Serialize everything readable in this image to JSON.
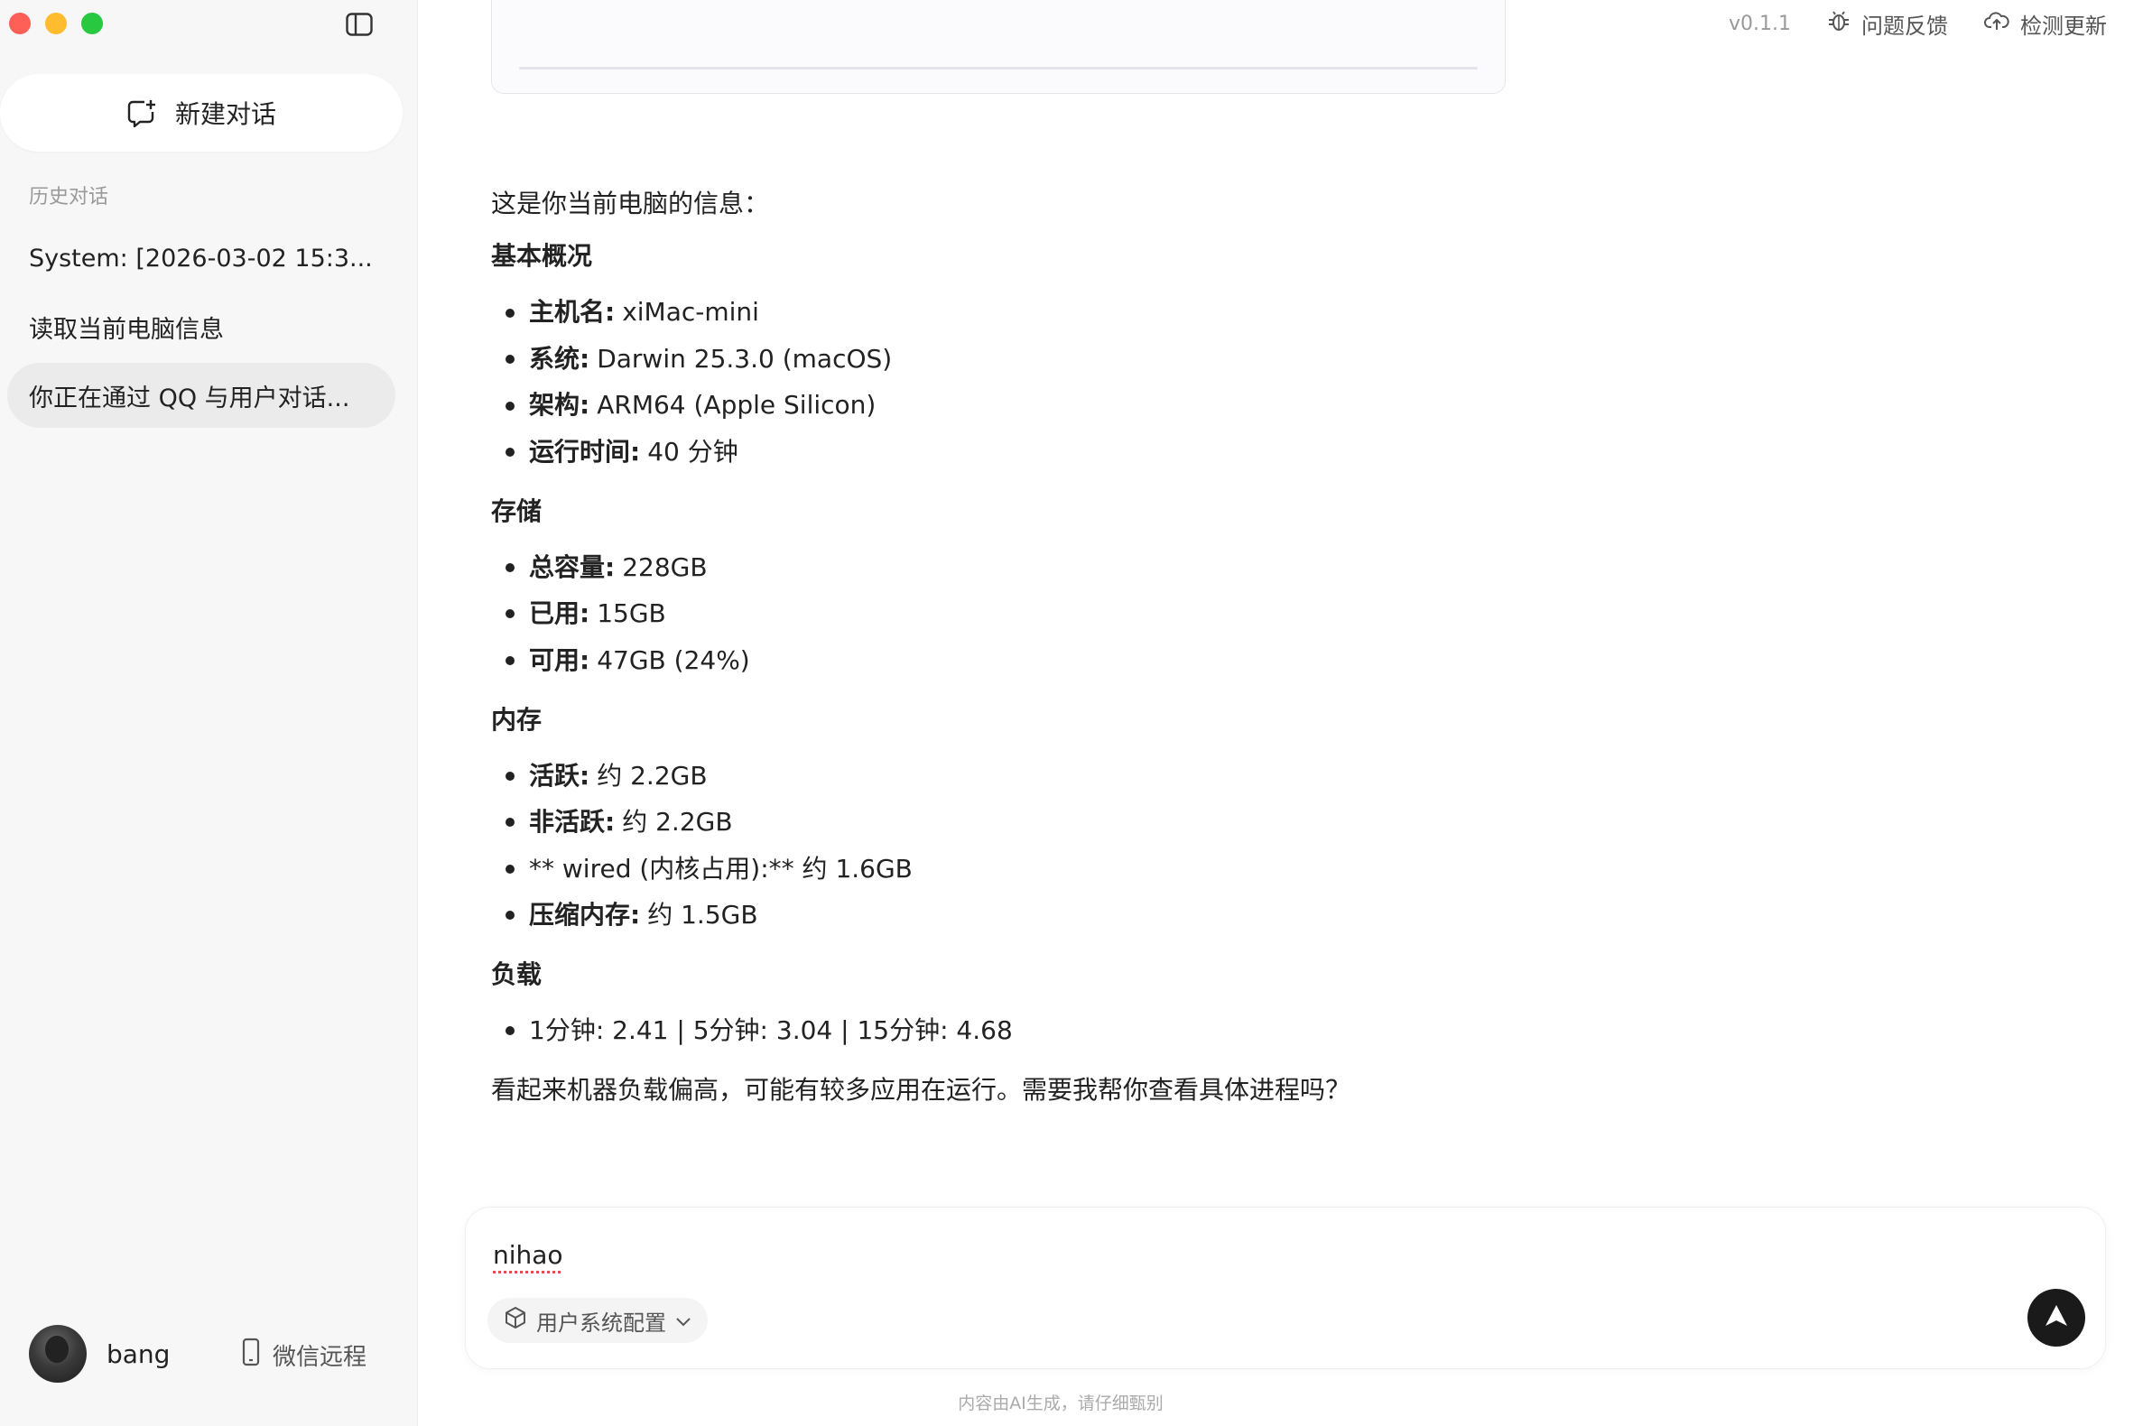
{
  "sidebar": {
    "new_chat_label": "新建对话",
    "history_title": "历史对话",
    "history": [
      {
        "label": "System: [2026-03-02 15:3..."
      },
      {
        "label": "读取当前电脑信息"
      },
      {
        "label": "你正在通过 QQ 与用户对话..."
      }
    ],
    "user_name": "bang",
    "remote_label": "微信远程"
  },
  "topbar": {
    "version": "v0.1.1",
    "feedback_label": "问题反馈",
    "update_label": "检测更新"
  },
  "message": {
    "intro": "这是你当前电脑的信息：",
    "sections": [
      {
        "title": "基本概况",
        "items": [
          {
            "key": "主机名:",
            "value": "xiMac-mini"
          },
          {
            "key": "系统:",
            "value": "Darwin 25.3.0 (macOS)"
          },
          {
            "key": "架构:",
            "value": "ARM64 (Apple Silicon)"
          },
          {
            "key": "运行时间:",
            "value": "40 分钟"
          }
        ]
      },
      {
        "title": "存储",
        "items": [
          {
            "key": "总容量:",
            "value": "228GB"
          },
          {
            "key": "已用:",
            "value": "15GB"
          },
          {
            "key": "可用:",
            "value": "47GB (24%)"
          }
        ]
      },
      {
        "title": "内存",
        "items": [
          {
            "key": "活跃:",
            "value": "约 2.2GB"
          },
          {
            "key": "非活跃:",
            "value": "约 2.2GB"
          },
          {
            "key": "",
            "value": "** wired (内核占用):** 约 1.6GB"
          },
          {
            "key": "压缩内存:",
            "value": "约 1.5GB"
          }
        ]
      },
      {
        "title": "负载",
        "items": [
          {
            "key": "",
            "value": "1分钟: 2.41 | 5分钟: 3.04 | 15分钟: 4.68"
          }
        ]
      }
    ],
    "closing": "看起来机器负载偏高，可能有较多应用在运行。需要我帮你查看具体进程吗？"
  },
  "composer": {
    "input_value": "nihao",
    "mode_label": "用户系统配置"
  },
  "footnote": "内容由AI生成，请仔细甄别"
}
